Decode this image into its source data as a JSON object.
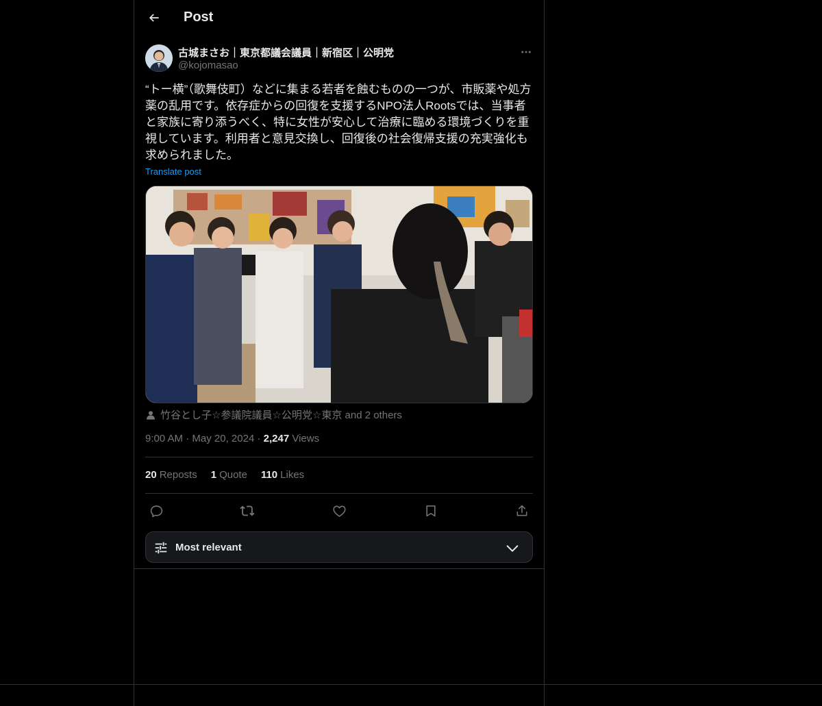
{
  "header": {
    "title": "Post"
  },
  "author": {
    "name": "古城まさお｜東京都議会議員｜新宿区｜公明党",
    "handle": "@kojomasao"
  },
  "post": {
    "text": "“トー横”（歌舞伎町）などに集まる若者を蝕むものの一つが、市販薬や処方薬の乱用です。依存症からの回復を支援するNPO法人Rootsでは、当事者と家族に寄り添うべく、特に女性が安心して治療に臨める環境づくりを重視しています。利用者と意見交換し、回復後の社会復帰支援の充実強化も求められました。",
    "translate_label": "Translate post",
    "tagged": "竹谷とし子☆参議院議員☆公明党☆東京 and 2 others",
    "time": "9:00 AM",
    "date": "May 20, 2024",
    "views_count": "2,247",
    "views_label": "Views"
  },
  "stats": {
    "reposts_count": "20",
    "reposts_label": "Reposts",
    "quotes_count": "1",
    "quotes_label": "Quote",
    "likes_count": "110",
    "likes_label": "Likes"
  },
  "sort": {
    "label": "Most relevant"
  },
  "icons": {
    "back": "back-arrow-icon",
    "more": "more-icon",
    "reply": "reply-icon",
    "repost": "repost-icon",
    "like": "heart-icon",
    "bookmark": "bookmark-icon",
    "share": "share-icon",
    "sort": "sliders-icon",
    "chevron": "chevron-down-icon",
    "tag": "person-icon"
  },
  "colors": {
    "background": "#000000",
    "text": "#e7e9ea",
    "secondary": "#71767b",
    "link": "#1d9bf0",
    "border": "#2f3336"
  }
}
